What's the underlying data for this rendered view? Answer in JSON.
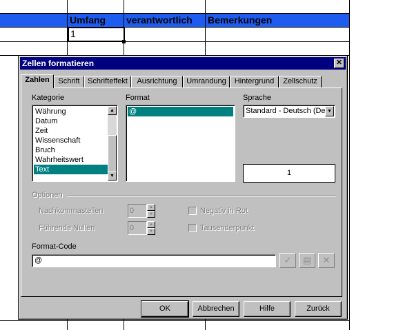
{
  "sheet": {
    "headers": [
      "Umfang",
      "verantwortlich",
      "Bemerkungen"
    ],
    "active_cell_value": "1",
    "header_color": "#1e5cf0"
  },
  "dialog": {
    "title": "Zellen formatieren",
    "close_glyph": "✕",
    "tabs": [
      {
        "label": "Zahlen",
        "active": true
      },
      {
        "label": "Schrift"
      },
      {
        "label": "Schrifteffekt"
      },
      {
        "label": "Ausrichtung"
      },
      {
        "label": "Umrandung"
      },
      {
        "label": "Hintergrund"
      },
      {
        "label": "Zellschutz"
      }
    ],
    "kategorie_label": "Kategorie",
    "kategorie_items": [
      "Währung",
      "Datum",
      "Zeit",
      "Wissenschaft",
      "Bruch",
      "Wahrheitswert",
      "Text"
    ],
    "kategorie_selected": "Text",
    "format_label": "Format",
    "format_items": [
      "@"
    ],
    "sprache_label": "Sprache",
    "sprache_value": "Standard - Deutsch (Deu",
    "preview_value": "1",
    "optionen_label": "Optionen",
    "nachkommastellen_label": "Nachkommastellen",
    "nachkommastellen_value": "0",
    "fuehrende_nullen_label": "Führende Nullen",
    "fuehrende_nullen_value": "0",
    "negativ_rot_label": "Negativ in Rot",
    "tausenderpunkt_label": "Tausenderpunkt",
    "format_code_label": "Format-Code",
    "format_code_value": "@",
    "buttons": {
      "ok": "OK",
      "abbrechen": "Abbrechen",
      "hilfe": "Hilfe",
      "zurueck": "Zurück"
    },
    "selection_color": "#008080",
    "titlebar_color": "#000080"
  }
}
